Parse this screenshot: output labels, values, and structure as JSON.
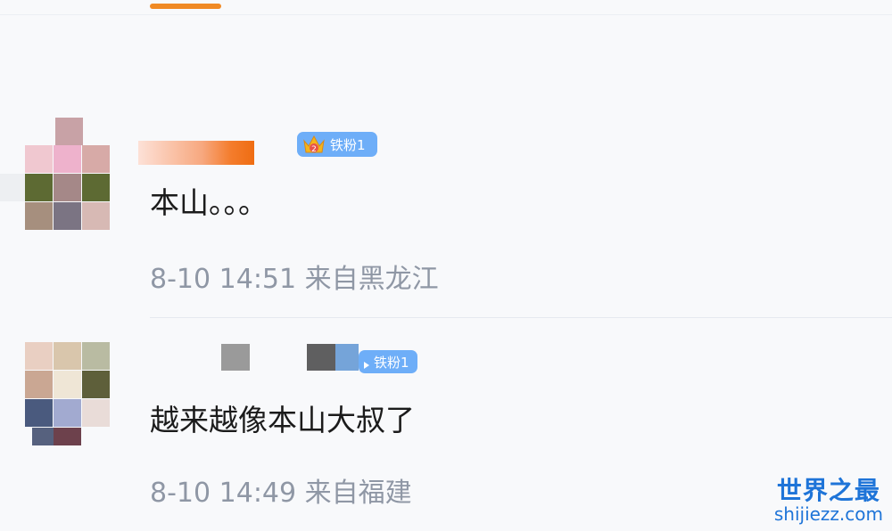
{
  "comments": [
    {
      "badge": "铁粉1",
      "text": "本山。。。",
      "date": "8-10",
      "time": "14:51",
      "location": "来自黑龙江"
    },
    {
      "badge": "铁粉1",
      "text": "越来越像本山大叔了",
      "date": "8-10",
      "time": "14:49",
      "location": "来自福建"
    }
  ],
  "colors": {
    "badge_bg": "#6eaef8",
    "accent_orange": "#f08a24",
    "meta_text": "#8f97a5",
    "watermark": "#1e74d8"
  },
  "icons": {
    "rank_icon": "crown-icon",
    "badge_arrow": "chevron-right-icon"
  },
  "watermark": {
    "title": "世界之最",
    "url": "shijiezz.com"
  }
}
